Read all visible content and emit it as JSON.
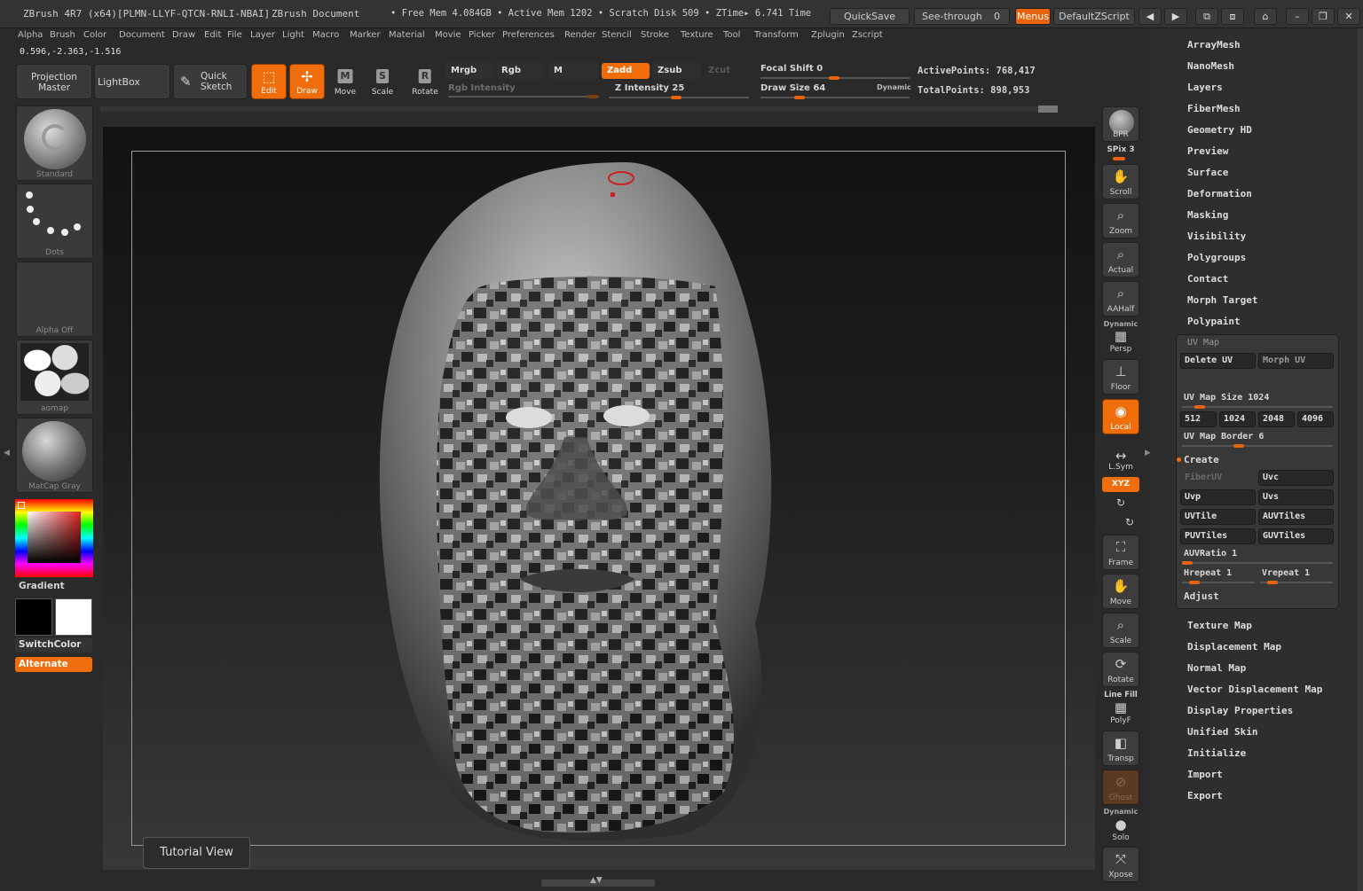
{
  "titlebar": {
    "app_title": "ZBrush 4R7 (x64)[PLMN-LLYF-QTCN-RNLI-NBAI]",
    "document": "ZBrush Document",
    "stats": "• Free Mem 4.084GB • Active Mem 1202 • Scratch Disk 509 • ZTime▸ 6.741 Time",
    "quicksave": "QuickSave",
    "see_through_label": "See-through",
    "see_through_value": "0",
    "menus": "Menus",
    "default_zscript": "DefaultZScript"
  },
  "menu": [
    "Alpha",
    "Brush",
    "Color",
    "Document",
    "Draw",
    "Edit",
    "File",
    "Layer",
    "Light",
    "Macro",
    "Marker",
    "Material",
    "Movie",
    "Picker",
    "Preferences",
    "Render",
    "Stencil",
    "Stroke",
    "Texture",
    "Tool",
    "Transform",
    "Zplugin",
    "Zscript"
  ],
  "coords": "0.596,-2.363,-1.516",
  "toolbar": {
    "projection_master": "Projection Master",
    "lightbox": "LightBox",
    "quick_sketch": "Quick Sketch",
    "edit": "Edit",
    "draw": "Draw",
    "move": "Move",
    "scale": "Scale",
    "rotate": "Rotate",
    "mrgb": "Mrgb",
    "rgb": "Rgb",
    "m": "M",
    "rgb_intensity": "Rgb Intensity",
    "zadd": "Zadd",
    "zsub": "Zsub",
    "zcut": "Zcut",
    "z_intensity_label": "Z Intensity",
    "z_intensity_value": "25",
    "focal_shift_label": "Focal Shift",
    "focal_shift_value": "0",
    "draw_size_label": "Draw Size",
    "draw_size_value": "64",
    "dynamic": "Dynamic",
    "active_points": "ActivePoints: 768,417",
    "total_points": "TotalPoints: 898,953"
  },
  "left": {
    "brush": "Standard",
    "stroke": "Dots",
    "alpha": "Alpha Off",
    "texture": "aomap",
    "material": "MatCap Gray",
    "gradient": "Gradient",
    "switch_color": "SwitchColor",
    "alternate": "Alternate"
  },
  "viewport": {
    "tutorial_view": "Tutorial View"
  },
  "shelf": {
    "bpr": "BPR",
    "spix": "SPix 3",
    "scroll": "Scroll",
    "zoom": "Zoom",
    "actual": "Actual",
    "aahalf": "AAHalf",
    "dynamic": "Dynamic",
    "persp": "Persp",
    "floor": "Floor",
    "local": "Local",
    "lsym": "L.Sym",
    "xyz": "XYZ",
    "frame": "Frame",
    "move": "Move",
    "scale": "Scale",
    "rotate": "Rotate",
    "line_fill": "Line Fill",
    "polyf": "PolyF",
    "transp": "Transp",
    "ghost": "Ghost",
    "dynamic2": "Dynamic",
    "solo": "Solo",
    "xpose": "Xpose"
  },
  "tool_menu": {
    "items_top": [
      "ArrayMesh",
      "NanoMesh",
      "Layers",
      "FiberMesh",
      "Geometry HD",
      "Preview",
      "Surface",
      "Deformation",
      "Masking",
      "Visibility",
      "Polygroups",
      "Contact",
      "Morph Target",
      "Polypaint"
    ],
    "uv_map": {
      "title": "UV Map",
      "delete_uv": "Delete UV",
      "morph_uv": "Morph UV",
      "uv_map_size_label": "UV Map Size",
      "uv_map_size_value": "1024",
      "sizes": [
        "512",
        "1024",
        "2048",
        "4096"
      ],
      "uv_map_border_label": "UV Map Border",
      "uv_map_border_value": "6",
      "create": "Create",
      "fiberuv": "FiberUV",
      "uvc": "Uvc",
      "uvp": "Uvp",
      "uvs": "Uvs",
      "uvtile": "UVTile",
      "auvtiles": "AUVTiles",
      "puvtiles": "PUVTiles",
      "guvtiles": "GUVTiles",
      "auvratio": "AUVRatio 1",
      "hrepeat": "Hrepeat 1",
      "vrepeat": "Vrepeat 1",
      "adjust": "Adjust"
    },
    "items_bottom": [
      "Texture Map",
      "Displacement Map",
      "Normal Map",
      "Vector Displacement Map",
      "Display Properties",
      "Unified Skin",
      "Initialize",
      "Import",
      "Export"
    ]
  },
  "colors": {
    "accent": "#ef6d0b",
    "panel": "#3a3a3a",
    "background": "#2a2a2a"
  }
}
